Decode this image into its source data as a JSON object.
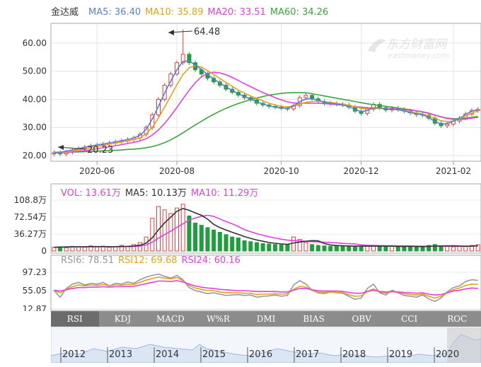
{
  "chart_data": [
    {
      "type": "candlestick",
      "title": "金达威",
      "legend": [
        {
          "label": "MA5: 36.40",
          "color": "#5b7fd6"
        },
        {
          "label": "MA10: 35.89",
          "color": "#e3a21a"
        },
        {
          "label": "MA20: 33.51",
          "color": "#e040e0"
        },
        {
          "label": "MA60: 34.26",
          "color": "#3aa63a"
        }
      ],
      "y_ticks": [
        "60.00",
        "50.00",
        "40.00",
        "30.00",
        "20.00"
      ],
      "ylim": [
        18,
        67
      ],
      "x_ticks": [
        "2020-06",
        "2020-08",
        "2020-10",
        "2020-12",
        "2021-02"
      ],
      "annotations": {
        "max": "64.48",
        "min": "20.23"
      },
      "closes": [
        21,
        20.6,
        21.2,
        22,
        22.6,
        23,
        23.4,
        23.8,
        24.1,
        24.5,
        24.9,
        25.2,
        25.7,
        26.3,
        27.6,
        30,
        34.5,
        40,
        45,
        49,
        53,
        56,
        53,
        50.5,
        49,
        47.5,
        46.2,
        45,
        43.6,
        42.5,
        41.5,
        40.6,
        39.8,
        38.6,
        38,
        37.5,
        37.2,
        36.8,
        36.6,
        37.8,
        40.6,
        41.4,
        40.2,
        39.2,
        38.6,
        38.5,
        38.3,
        38,
        37.2,
        35.8,
        35,
        36.5,
        38.2,
        37,
        36.2,
        36.8,
        36.4,
        35.8,
        35.2,
        34.6,
        34.4,
        33.3,
        31.5,
        30.6,
        31.2,
        32.3,
        33.3,
        34.8,
        36,
        36.4
      ],
      "ma5": [
        21,
        21.2,
        21.6,
        22,
        22.5,
        23,
        23.4,
        23.8,
        24.1,
        24.5,
        24.9,
        25.3,
        25.7,
        26.3,
        27.2,
        29.3,
        33,
        37.5,
        42.2,
        46.5,
        50.5,
        53.5,
        53.6,
        52.2,
        50.6,
        48.8,
        47.2,
        45.8,
        44.4,
        43.2,
        42,
        41,
        40.1,
        39.1,
        38.3,
        37.7,
        37.2,
        36.9,
        36.8,
        37.6,
        39.2,
        40.1,
        40.2,
        39.7,
        39,
        38.6,
        38.3,
        38,
        37.4,
        36.4,
        35.6,
        36,
        37,
        37,
        36.5,
        36.5,
        36.3,
        35.9,
        35.3,
        34.8,
        34.5,
        33.5,
        32.1,
        31.2,
        31.4,
        32.2,
        33.2,
        34.6,
        35.8,
        36.4
      ],
      "ma10": [
        21,
        21.1,
        21.3,
        21.6,
        22,
        22.4,
        22.8,
        23.2,
        23.6,
        24,
        24.4,
        24.8,
        25.2,
        25.7,
        26.3,
        27.7,
        30,
        33.4,
        37.2,
        41.2,
        45.2,
        48.8,
        51.2,
        52,
        51.5,
        50.2,
        48.8,
        47.4,
        46,
        44.6,
        43.3,
        42.2,
        41.2,
        40.3,
        39.4,
        38.6,
        38,
        37.5,
        37.3,
        37.6,
        38.3,
        38.9,
        39.2,
        39.3,
        39.1,
        38.9,
        38.6,
        38.3,
        37.9,
        37.3,
        36.8,
        36.6,
        36.7,
        36.8,
        36.6,
        36.5,
        36.3,
        36,
        35.6,
        35.2,
        34.8,
        34.1,
        33.2,
        32.4,
        32.1,
        32.3,
        33,
        34,
        35.1,
        35.9
      ],
      "ma20": [
        21,
        21,
        21.1,
        21.3,
        21.5,
        21.8,
        22.1,
        22.4,
        22.8,
        23.1,
        23.5,
        23.9,
        24.3,
        24.7,
        25.2,
        26,
        27.3,
        29.1,
        31.4,
        34.1,
        37.1,
        40.2,
        43.2,
        45.9,
        48,
        49.2,
        49.6,
        49.4,
        48.7,
        47.8,
        46.7,
        45.6,
        44.5,
        43.4,
        42.4,
        41.5,
        40.6,
        39.8,
        39.1,
        38.7,
        38.6,
        38.6,
        38.6,
        38.6,
        38.5,
        38.3,
        38.1,
        37.9,
        37.7,
        37.4,
        37.2,
        37,
        36.9,
        36.8,
        36.7,
        36.6,
        36.5,
        36.4,
        36.2,
        35.9,
        35.6,
        35.1,
        34.4,
        33.7,
        33.2,
        32.9,
        32.8,
        33,
        33.3,
        33.6
      ],
      "ma60": [
        21.2,
        21.2,
        21.2,
        21.3,
        21.3,
        21.4,
        21.5,
        21.6,
        21.7,
        21.8,
        21.9,
        22,
        22.2,
        22.3,
        22.5,
        22.8,
        23.2,
        23.8,
        24.6,
        25.6,
        26.8,
        28.1,
        29.5,
        30.9,
        32.2,
        33.5,
        34.7,
        35.8,
        36.8,
        37.7,
        38.5,
        39.2,
        39.9,
        40.5,
        41,
        41.5,
        41.8,
        42.1,
        42.3,
        42.4,
        42.4,
        42.3,
        42,
        41.6,
        41.2,
        40.8,
        40.4,
        40,
        39.6,
        39.2,
        38.8,
        38.4,
        38.1,
        37.8,
        37.5,
        37.2,
        36.9,
        36.6,
        36.3,
        35.9,
        35.5,
        35,
        34.4,
        33.8,
        33.3,
        33.1,
        33.1,
        33.3,
        33.6,
        33.9
      ]
    },
    {
      "type": "bar",
      "legend": [
        {
          "label": "VOL: 13.61万",
          "color": "#e040e0"
        },
        {
          "label": "MA5: 10.13万",
          "color": "#333333"
        },
        {
          "label": "MA10: 11.29万",
          "color": "#e040e0"
        }
      ],
      "y_ticks": [
        "108.8万",
        "72.54万",
        "36.27万",
        "0"
      ],
      "ylim": [
        0,
        108.8
      ],
      "values": [
        8,
        9,
        7,
        10,
        9,
        8,
        11,
        9,
        10,
        8,
        9,
        12,
        10,
        14,
        18,
        30,
        70,
        95,
        88,
        80,
        92,
        100,
        75,
        60,
        55,
        50,
        45,
        40,
        35,
        30,
        28,
        22,
        20,
        18,
        16,
        15,
        14,
        13,
        14,
        30,
        25,
        18,
        14,
        12,
        11,
        10,
        12,
        11,
        10,
        9,
        10,
        12,
        11,
        10,
        9,
        10,
        9,
        11,
        10,
        9,
        8,
        12,
        14,
        11,
        10,
        9,
        10,
        11,
        12,
        13.61
      ],
      "ma5": [
        8,
        8.5,
        8.7,
        9,
        9,
        9,
        9.5,
        9.4,
        9.6,
        9.2,
        9.4,
        9.8,
        9.9,
        10.8,
        12.6,
        16.8,
        28.4,
        45.4,
        60.2,
        72.6,
        85,
        91,
        87,
        81.4,
        76.4,
        68,
        57,
        50,
        45,
        40,
        35.6,
        31,
        27,
        23.6,
        20.8,
        18.2,
        16.6,
        15.2,
        14.4,
        17.2,
        19.2,
        20.8,
        22.2,
        21.8,
        16,
        13,
        11.8,
        11.2,
        10.8,
        10.4,
        10.4,
        10.4,
        10.4,
        10.4,
        10.4,
        10.4,
        9.8,
        9.8,
        9.8,
        9.8,
        9.4,
        10,
        10.6,
        10.8,
        11,
        11.2,
        10.8,
        10.2,
        10.4,
        11.3
      ],
      "ma10": [
        8,
        8.3,
        8.5,
        8.7,
        8.9,
        9,
        9.2,
        9.2,
        9.3,
        9.1,
        9.2,
        9.4,
        9.5,
        9.9,
        10.6,
        12.8,
        18.7,
        27.4,
        35.2,
        42.4,
        50.5,
        58,
        66,
        70.6,
        74.3,
        76.5,
        74,
        68.5,
        63,
        58.2,
        52.3,
        45.6,
        41.2,
        37.1,
        33.8,
        30.5,
        27.8,
        25.3,
        23.2,
        22.4,
        21.6,
        20.8,
        19.9,
        19.3,
        18.8,
        18,
        17.6,
        16.3,
        15.6,
        14.9,
        13.2,
        12.4,
        11.9,
        11.6,
        11.4,
        11.4,
        11.1,
        11,
        10.9,
        10.6,
        10.3,
        10.3,
        10.3,
        10.4,
        10.5,
        10.5,
        10.2,
        10.1,
        10.4,
        10.9
      ]
    },
    {
      "type": "line",
      "legend": [
        {
          "label": "RSI6: 78.51",
          "color": "#999999"
        },
        {
          "label": "RSI12: 69.68",
          "color": "#e3a21a"
        },
        {
          "label": "RSI24: 60.16",
          "color": "#e040e0"
        }
      ],
      "y_ticks": [
        "97.23",
        "55.05",
        "12.87"
      ],
      "ylim": [
        12.87,
        97.23
      ],
      "rsi6": [
        55,
        40,
        60,
        70,
        74,
        68,
        72,
        70,
        74,
        66,
        72,
        70,
        75,
        72,
        80,
        86,
        90,
        93,
        88,
        84,
        90,
        80,
        62,
        55,
        52,
        48,
        50,
        47,
        44,
        45,
        46,
        44,
        45,
        40,
        42,
        43,
        45,
        42,
        44,
        68,
        78,
        70,
        56,
        50,
        48,
        52,
        50,
        49,
        42,
        35,
        38,
        60,
        70,
        50,
        45,
        56,
        50,
        44,
        42,
        40,
        45,
        36,
        30,
        38,
        52,
        62,
        66,
        76,
        80,
        78.51
      ],
      "rsi12": [
        55,
        50,
        58,
        64,
        68,
        66,
        68,
        67,
        69,
        66,
        68,
        67,
        70,
        69,
        74,
        79,
        83,
        86,
        84,
        82,
        85,
        78,
        67,
        61,
        58,
        55,
        55,
        52,
        50,
        50,
        50,
        49,
        49,
        46,
        47,
        47,
        48,
        47,
        48,
        58,
        65,
        63,
        56,
        52,
        51,
        52,
        51,
        50,
        46,
        42,
        43,
        53,
        59,
        52,
        49,
        53,
        51,
        48,
        46,
        45,
        47,
        42,
        38,
        42,
        50,
        57,
        61,
        67,
        70,
        69.68
      ],
      "rsi24": [
        56,
        54,
        57,
        60,
        62,
        62,
        63,
        63,
        64,
        63,
        64,
        64,
        65,
        65,
        68,
        71,
        74,
        77,
        77,
        76,
        78,
        75,
        70,
        66,
        63,
        61,
        60,
        58,
        57,
        56,
        55,
        55,
        54,
        53,
        53,
        53,
        53,
        52,
        52,
        56,
        60,
        60,
        57,
        55,
        54,
        54,
        54,
        53,
        51,
        49,
        49,
        53,
        56,
        53,
        52,
        53,
        52,
        51,
        50,
        49,
        50,
        47,
        45,
        46,
        50,
        54,
        56,
        59,
        61,
        60.16
      ]
    }
  ],
  "watermark": {
    "brand": "东方财富网",
    "domain": "eastmoney.com"
  },
  "indicator_tabs": [
    "RSI",
    "KDJ",
    "MACD",
    "W%R",
    "DMI",
    "BIAS",
    "OBV",
    "CCI",
    "ROC"
  ],
  "active_tab": "RSI",
  "navigator": {
    "years": [
      "2012",
      "2013",
      "2014",
      "2015",
      "2016",
      "2017",
      "2018",
      "2019",
      "2020"
    ]
  }
}
